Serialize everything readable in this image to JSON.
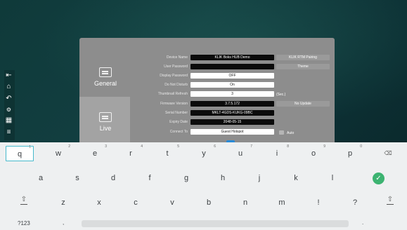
{
  "dialog": {
    "tabs": [
      {
        "label": "General"
      },
      {
        "label": "Live"
      }
    ],
    "rows": [
      {
        "label": "Device Name",
        "value": "KLIK Boks HUB Demo",
        "style": "black"
      },
      {
        "label": "User Password",
        "value": "",
        "style": "black"
      },
      {
        "label": "Display Password",
        "value": "OFF",
        "style": "white"
      },
      {
        "label": "Do Not Disturb",
        "value": "On",
        "style": "white"
      },
      {
        "label": "Thumbnail Refresh",
        "value": "3",
        "style": "white"
      },
      {
        "label": "Firmware Version",
        "value": "3.7.5.172",
        "style": "black"
      },
      {
        "label": "Serial Number",
        "value": "MKLT-4GDS-KUKG-09BC",
        "style": "black"
      },
      {
        "label": "Expiry Date",
        "value": "2048-05-15",
        "style": "black"
      },
      {
        "label": "Connect To",
        "value": "Guest Hotspot",
        "style": "white"
      }
    ],
    "right": {
      "pairing_button": "KLIK RTM Pairing",
      "theme_button": "Theme",
      "sec_label": "(Sec.)",
      "update_button": "No Update",
      "auto_label": "Auto"
    }
  },
  "keyboard": {
    "row1": [
      {
        "key": "q",
        "hint": "1"
      },
      {
        "key": "w",
        "hint": "2"
      },
      {
        "key": "e",
        "hint": "3"
      },
      {
        "key": "r",
        "hint": "4"
      },
      {
        "key": "t",
        "hint": "5"
      },
      {
        "key": "y",
        "hint": "6"
      },
      {
        "key": "u",
        "hint": "7"
      },
      {
        "key": "i",
        "hint": "8"
      },
      {
        "key": "o",
        "hint": "9"
      },
      {
        "key": "p",
        "hint": "0"
      }
    ],
    "row2": [
      "a",
      "s",
      "d",
      "f",
      "g",
      "h",
      "j",
      "k",
      "l"
    ],
    "row3": [
      "z",
      "x",
      "c",
      "v",
      "b",
      "n",
      "m",
      "!",
      "?"
    ],
    "symbols_label": "?123",
    "comma": ",",
    "period": "."
  },
  "icons": {
    "backspace": "backspace-icon",
    "enter": "check-icon",
    "shift": "shift-icon",
    "close": "close-icon"
  },
  "colors": {
    "accent": "#46b9cc",
    "enter": "#3cb371",
    "slider": "#2a8ad6"
  }
}
